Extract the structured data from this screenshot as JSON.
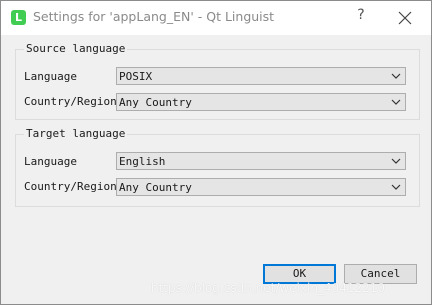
{
  "window": {
    "title": "Settings for 'appLang_EN' - Qt Linguist",
    "app_icon_letter": "L",
    "help_label": "?",
    "close_icon": "close-icon",
    "accent_color": "#0078d7",
    "icon_color": "#41cd52"
  },
  "source": {
    "legend": "Source language",
    "language_label": "Language",
    "language_value": "POSIX",
    "country_label": "Country/Region",
    "country_value": "Any Country"
  },
  "target": {
    "legend": "Target language",
    "language_label": "Language",
    "language_value": "English",
    "country_label": "Country/Region",
    "country_value": "Any Country"
  },
  "buttons": {
    "ok_label": "OK",
    "cancel_label": "Cancel"
  },
  "watermark": "https://blog.csdn.net/weixin_40412210"
}
